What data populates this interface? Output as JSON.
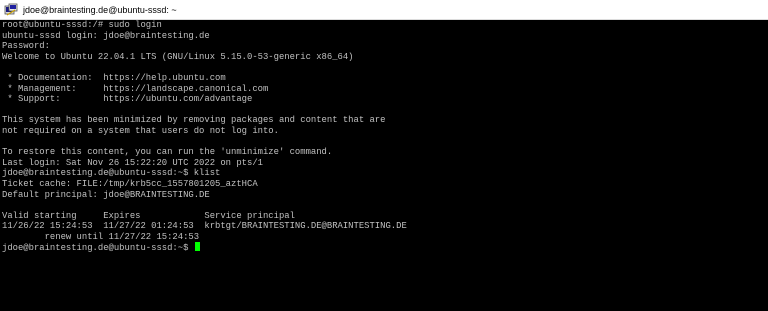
{
  "window": {
    "title": "jdoe@braintesting.de@ubuntu-sssd: ~"
  },
  "terminal": {
    "lines": [
      "root@ubuntu-sssd:/# sudo login",
      "ubuntu-sssd login: jdoe@braintesting.de",
      "Password:",
      "Welcome to Ubuntu 22.04.1 LTS (GNU/Linux 5.15.0-53-generic x86_64)",
      "",
      " * Documentation:  https://help.ubuntu.com",
      " * Management:     https://landscape.canonical.com",
      " * Support:        https://ubuntu.com/advantage",
      "",
      "This system has been minimized by removing packages and content that are",
      "not required on a system that users do not log into.",
      "",
      "To restore this content, you can run the 'unminimize' command.",
      "Last login: Sat Nov 26 15:22:20 UTC 2022 on pts/1",
      "jdoe@braintesting.de@ubuntu-sssd:~$ klist",
      "Ticket cache: FILE:/tmp/krb5cc_1557801205_aztHCA",
      "Default principal: jdoe@BRAINTESTING.DE",
      "",
      "Valid starting     Expires            Service principal",
      "11/26/22 15:24:53  11/27/22 01:24:53  krbtgt/BRAINTESTING.DE@BRAINTESTING.DE",
      "        renew until 11/27/22 15:24:53"
    ],
    "prompt": "jdoe@braintesting.de@ubuntu-sssd:~$ "
  },
  "colors": {
    "background": "#000000",
    "text": "#c0c0c0",
    "cursor": "#00ff00"
  },
  "icons": {
    "app": "putty-terminal-icon"
  }
}
